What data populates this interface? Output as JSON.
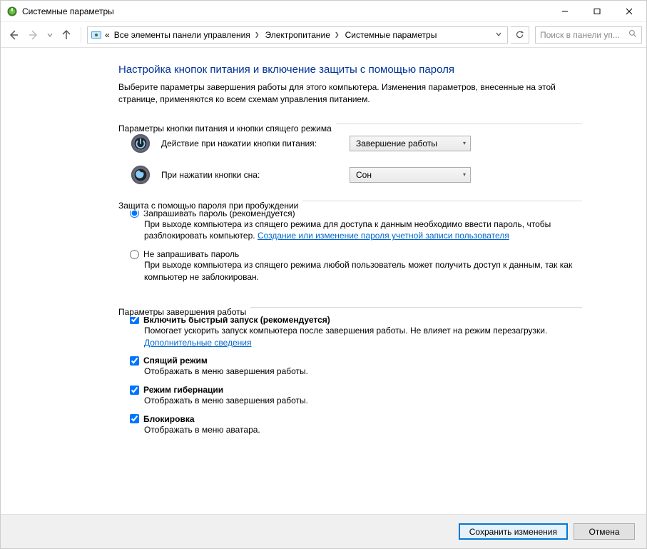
{
  "window": {
    "title": "Системные параметры"
  },
  "breadcrumb": {
    "prefix": "«",
    "items": [
      "Все элементы панели управления",
      "Электропитание",
      "Системные параметры"
    ]
  },
  "search": {
    "placeholder": "Поиск в панели уп..."
  },
  "page": {
    "heading": "Настройка кнопок питания и включение защиты с помощью пароля",
    "intro": "Выберите параметры завершения работы для этого компьютера. Изменения параметров, внесенные на этой странице, применяются ко всем схемам управления питанием."
  },
  "group_power": {
    "legend": "Параметры кнопки питания и кнопки спящего режима",
    "row1_label": "Действие при нажатии кнопки питания:",
    "row1_value": "Завершение работы",
    "row2_label": "При нажатии кнопки сна:",
    "row2_value": "Сон"
  },
  "group_wake": {
    "legend": "Защита с помощью пароля при пробуждении",
    "opt1_label": "Запрашивать пароль (рекомендуется)",
    "opt1_desc_a": "При выходе компьютера из спящего режима для доступа к данным необходимо ввести пароль, чтобы разблокировать компьютер. ",
    "opt1_link": "Создание или изменение пароля учетной записи пользователя",
    "opt2_label": "Не запрашивать пароль",
    "opt2_desc": "При выходе компьютера из спящего режима любой пользователь может получить доступ к данным, так как компьютер не заблокирован."
  },
  "group_shutdown": {
    "legend": "Параметры завершения работы",
    "c1_label": "Включить быстрый запуск (рекомендуется)",
    "c1_desc_a": "Помогает ускорить запуск компьютера после завершения работы. Не влияет на режим перезагрузки. ",
    "c1_link": "Дополнительные сведения",
    "c2_label": "Спящий режим",
    "c2_desc": "Отображать в меню завершения работы.",
    "c3_label": "Режим гибернации",
    "c3_desc": "Отображать в меню завершения работы.",
    "c4_label": "Блокировка",
    "c4_desc": "Отображать в меню аватара."
  },
  "footer": {
    "save": "Сохранить изменения",
    "cancel": "Отмена"
  }
}
